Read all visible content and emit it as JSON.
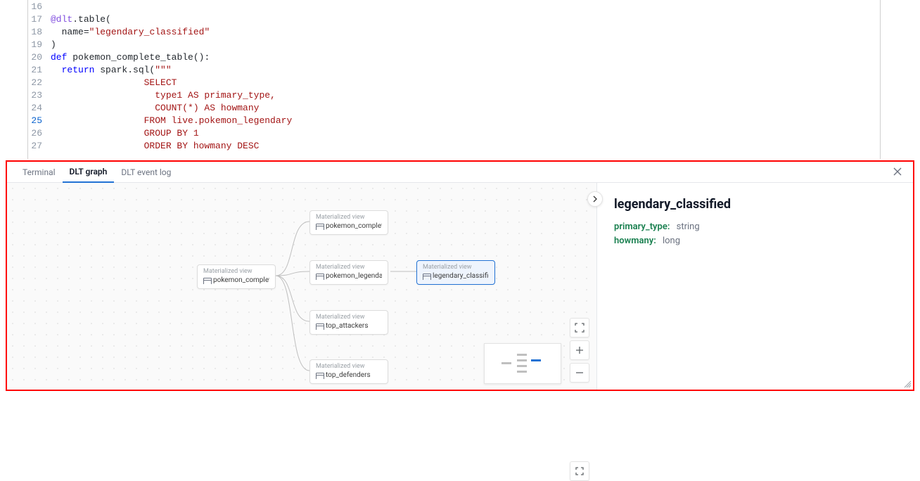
{
  "editor": {
    "lines": [
      {
        "n": 16,
        "segments": []
      },
      {
        "n": 17,
        "segments": [
          {
            "t": "@dlt",
            "c": "tok-deco"
          },
          {
            "t": ".table(",
            "c": "tok-punc"
          }
        ]
      },
      {
        "n": 18,
        "segments": [
          {
            "t": "  ",
            "c": "tok-punc"
          },
          {
            "t": "name",
            "c": "tok-param"
          },
          {
            "t": "=",
            "c": "tok-punc"
          },
          {
            "t": "\"legendary_classified\"",
            "c": "tok-str"
          }
        ]
      },
      {
        "n": 19,
        "segments": [
          {
            "t": ")",
            "c": "tok-punc"
          }
        ]
      },
      {
        "n": 20,
        "segments": [
          {
            "t": "def ",
            "c": "tok-def"
          },
          {
            "t": "pokemon_complete_table",
            "c": "tok-name"
          },
          {
            "t": "():",
            "c": "tok-punc"
          }
        ]
      },
      {
        "n": 21,
        "segments": [
          {
            "t": "  ",
            "c": "tok-punc"
          },
          {
            "t": "return ",
            "c": "tok-kw"
          },
          {
            "t": "spark.sql(",
            "c": "tok-call"
          },
          {
            "t": "\"\"\"",
            "c": "tok-str"
          }
        ]
      },
      {
        "n": 22,
        "segments": [
          {
            "t": "                 SELECT",
            "c": "tok-str"
          }
        ]
      },
      {
        "n": 23,
        "segments": [
          {
            "t": "                   type1 AS primary_type,",
            "c": "tok-str"
          }
        ]
      },
      {
        "n": 24,
        "segments": [
          {
            "t": "                   COUNT(*) AS howmany",
            "c": "tok-str"
          }
        ]
      },
      {
        "n": 25,
        "active": true,
        "segments": [
          {
            "t": "                 FROM live.pokemon_legendary",
            "c": "tok-str"
          }
        ]
      },
      {
        "n": 26,
        "segments": [
          {
            "t": "                 GROUP BY 1",
            "c": "tok-str"
          }
        ]
      },
      {
        "n": 27,
        "segments": [
          {
            "t": "                 ORDER BY howmany DESC",
            "c": "tok-str"
          }
        ]
      }
    ]
  },
  "panel": {
    "tabs": [
      {
        "label": "Terminal",
        "active": false
      },
      {
        "label": "DLT graph",
        "active": true
      },
      {
        "label": "DLT event log",
        "active": false
      }
    ]
  },
  "graph": {
    "nodeTypeLabel": "Materialized view",
    "nodes": {
      "root": "pokemon_complete",
      "n1": "pokemon_complet...",
      "n2": "pokemon_legendary",
      "n3": "top_attackers",
      "n4": "top_defenders",
      "sel": "legendary_classified"
    }
  },
  "details": {
    "title": "legendary_classified",
    "schema": [
      {
        "name": "primary_type:",
        "type": "string"
      },
      {
        "name": "howmany:",
        "type": "long"
      }
    ]
  }
}
